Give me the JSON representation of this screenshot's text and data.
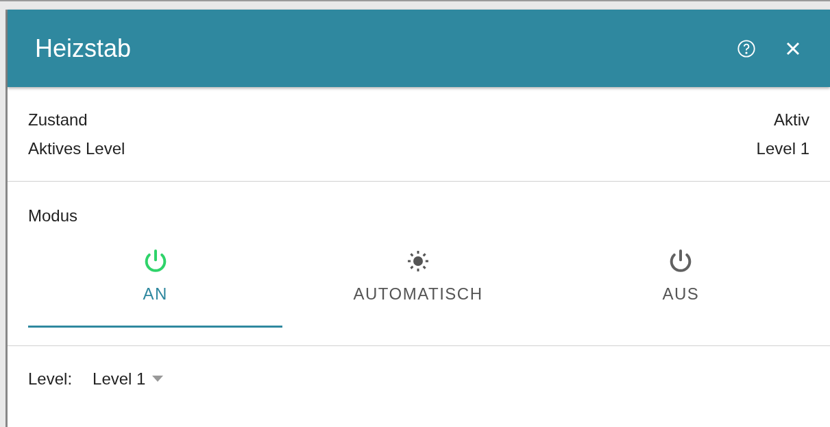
{
  "dialog": {
    "title": "Heizstab"
  },
  "status": [
    {
      "label": "Zustand",
      "value": "Aktiv"
    },
    {
      "label": "Aktives Level",
      "value": "Level 1"
    }
  ],
  "mode": {
    "label": "Modus",
    "tabs": [
      {
        "label": "AN",
        "kind": "power",
        "color": "#2fd36a",
        "selected": true
      },
      {
        "label": "AUTOMATISCH",
        "kind": "sun",
        "color": "#555555",
        "selected": false
      },
      {
        "label": "AUS",
        "kind": "power",
        "color": "#616161",
        "selected": false
      }
    ]
  },
  "level": {
    "label": "Level:",
    "value": "Level 1"
  }
}
